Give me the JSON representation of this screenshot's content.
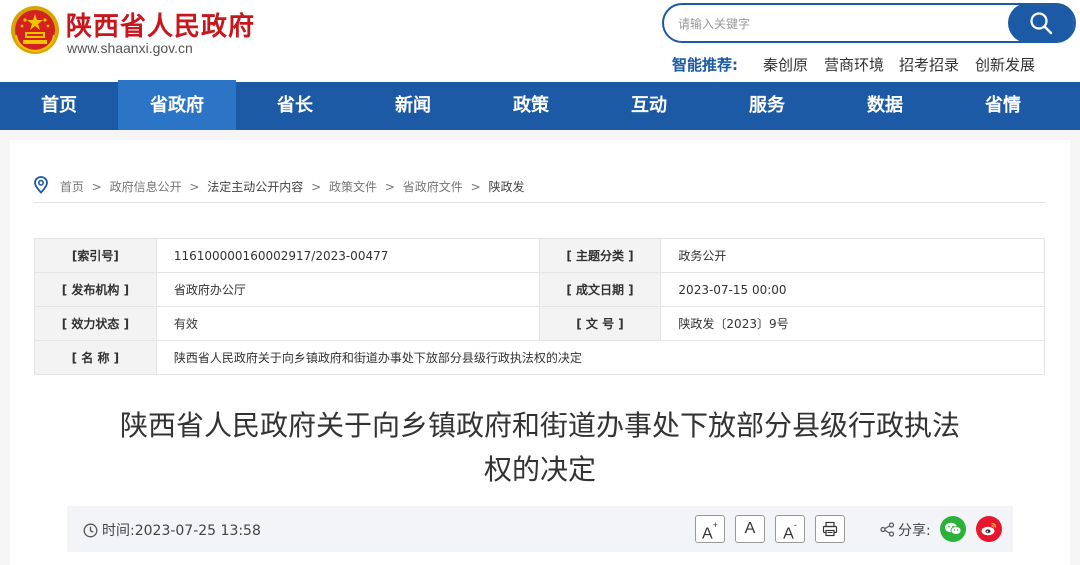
{
  "header": {
    "site_name": "陕西省人民政府",
    "site_domain": "www.shaanxi.gov.cn",
    "search_placeholder": "请输入关键字",
    "smart_label": "智能推荐:",
    "smart_links": [
      "秦创原",
      "营商环境",
      "招考招录",
      "创新发展"
    ]
  },
  "nav": {
    "items": [
      "首页",
      "省政府",
      "省长",
      "新闻",
      "政策",
      "互动",
      "服务",
      "数据",
      "省情"
    ],
    "active_index": 1
  },
  "breadcrumb": [
    "首页",
    "政府信息公开",
    "法定主动公开内容",
    "政策文件",
    "省政府文件",
    "陕政发"
  ],
  "meta": {
    "index_no_label": "[索引号]",
    "index_no": "116100000160002917/2023-00477",
    "topic_label": "[ 主题分类 ]",
    "topic": "政务公开",
    "issuer_label": "[ 发布机构 ]",
    "issuer": "省政府办公厅",
    "date_label": "[ 成文日期 ]",
    "date": "2023-07-15 00:00",
    "status_label": "[ 效力状态 ]",
    "status": "有效",
    "doc_no_label": "[ 文 号 ]",
    "doc_no": "陕政发〔2023〕9号",
    "name_label": "[ 名 称 ]",
    "name": "陕西省人民政府关于向乡镇政府和街道办事处下放部分县级行政执法权的决定"
  },
  "article": {
    "title_line1": "陕西省人民政府关于向乡镇政府和街道办事处下放部分县级行政执法",
    "title_line2": "权的决定"
  },
  "toolbar": {
    "time_label": "时间:",
    "time_value": "2023-07-25 13:58",
    "font_large": "A",
    "font_large_sup": "+",
    "font_normal": "A",
    "font_small": "A",
    "font_small_sup": "-",
    "share_label": "分享:"
  },
  "colors": {
    "brand_red": "#c8161d",
    "nav_blue": "#1c5aa6",
    "nav_active": "#2b74c6",
    "wechat_green": "#2bb23a",
    "weibo_red": "#e6162d"
  }
}
